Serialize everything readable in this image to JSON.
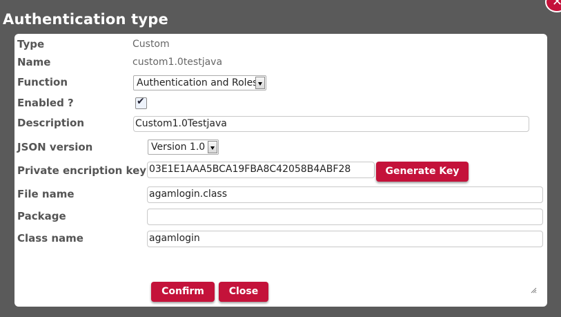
{
  "dialog": {
    "title": "Authentication type"
  },
  "fields": {
    "type": {
      "label": "Type",
      "value": "Custom"
    },
    "name": {
      "label": "Name",
      "value": "custom1.0testjava"
    },
    "function": {
      "label": "Function",
      "value": "Authentication and Roles"
    },
    "enabled": {
      "label": "Enabled ?",
      "checked": true
    },
    "description": {
      "label": "Description",
      "value": "Custom1.0Testjava"
    },
    "json_version": {
      "label": "JSON version",
      "value": "Version 1.0"
    },
    "private_key": {
      "label": "Private encription key",
      "value": "03E1E1AAA5BCA19FBA8C42058B4ABF28"
    },
    "file_name": {
      "label": "File name",
      "value": "agamlogin.class"
    },
    "package": {
      "label": "Package",
      "value": ""
    },
    "class_name": {
      "label": "Class name",
      "value": "agamlogin"
    }
  },
  "buttons": {
    "generate_key": "Generate Key",
    "confirm": "Confirm",
    "close": "Close"
  },
  "colors": {
    "accent": "#c4123a",
    "backdrop": "#5a5a5a"
  },
  "icons": {
    "close": "close-icon",
    "checkmark": "checkmark-icon",
    "resize": "resize-grip-icon"
  }
}
